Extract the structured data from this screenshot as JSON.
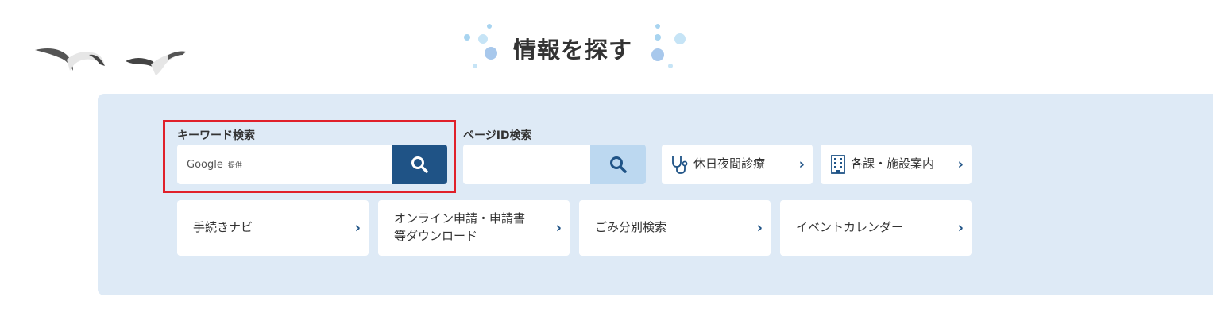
{
  "section": {
    "title": "情報を探す"
  },
  "keyword_search": {
    "label": "キーワード検索",
    "placeholder_brand": "Google",
    "placeholder_suffix": "提供",
    "search_icon": "search-icon"
  },
  "page_id_search": {
    "label": "ページID検索",
    "value": "",
    "search_icon": "search-icon"
  },
  "quick_links": [
    {
      "label": "休日夜間診療",
      "icon": "stethoscope-icon"
    },
    {
      "label": "各課・施設案内",
      "icon": "building-icon"
    }
  ],
  "nav_links": [
    {
      "label": "手続きナビ"
    },
    {
      "line1": "オンライン申請・申請書",
      "line2": "等ダウンロード"
    },
    {
      "label": "ごみ分別検索"
    },
    {
      "label": "イベントカレンダー"
    }
  ],
  "colors": {
    "panel_bg": "#deeaf6",
    "primary": "#1f5386",
    "light_button": "#bcd8f0",
    "highlight": "#e0202a"
  }
}
